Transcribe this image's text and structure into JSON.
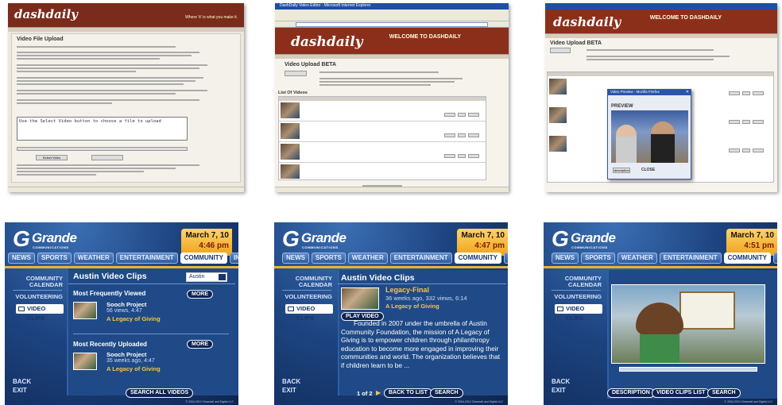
{
  "dashdaily": {
    "logo": "dashdaily",
    "welcome": "WELCOME TO DASHDAILY",
    "tagline": "Where 'it' is what you make it.",
    "upload_title": "Video File Upload",
    "upload_beta_title": "Video Upload BETA",
    "browser_title": "DashDaily Video Editor - Microsoft Internet Explorer",
    "list_title": "List Of Videos",
    "preview_window_title": "Video Preview - Mozilla Firefox",
    "preview_label": "PREVIEW",
    "preview_desc_btn": "description",
    "preview_close": "CLOSE",
    "textarea_text": "Use the Select Video button to choose a file to upload",
    "select_button": "Select Video",
    "upload_button": "Upload"
  },
  "grande": {
    "logo_word": "Grande",
    "logo_sub": "COMMUNICATIONS",
    "date": "March 7, 10",
    "tabs": [
      "NEWS",
      "SPORTS",
      "WEATHER",
      "ENTERTAINMENT",
      "COMMUNITY",
      "INFO"
    ],
    "nav": {
      "calendar": "COMMUNITY CALENDAR",
      "volunteering": "VOLUNTEERING",
      "video_clips": "VIDEO CLIPS",
      "back": "BACK",
      "exit": "EXIT"
    },
    "copyright": "© 2004-2010 Clearwell and Digital LLC",
    "screens": [
      {
        "time": "4:46 pm",
        "title": "Austin Video Clips",
        "city": "Austin",
        "most_viewed_label": "Most Frequently Viewed",
        "more": "MORE",
        "clip1_name": "Sooch Project",
        "clip1_meta": "56 views, 4:47",
        "clip1_sub": "A Legacy of Giving",
        "most_recent_label": "Most Recently Uploaded",
        "clip2_name": "Sooch Project",
        "clip2_meta": "35 weeks ago, 4:47",
        "clip2_sub": "A Legacy of Giving",
        "search_all": "SEARCH ALL VIDEOS"
      },
      {
        "time": "4:47 pm",
        "title": "Austin Video Clips",
        "clip_name": "Legacy-Final",
        "clip_meta": "36 weeks ago, 332 views, 6:14",
        "clip_sub": "A Legacy of Giving",
        "play": "PLAY VIDEO",
        "description": "Founded in 2007 under the umbrella of Austin Community Foundation, the mission of A Legacy of Giving is to empower children through philanthropy education to become more engaged in improving their communities and world. The organization believes that if children learn to be ...",
        "pager": "1 of 2",
        "back_to_list": "BACK TO LIST",
        "search": "SEARCH"
      },
      {
        "time": "4:51 pm",
        "video_progress": 0.0,
        "description_btn": "DESCRIPTION",
        "clips_list_btn": "VIDEO CLIPS LIST",
        "search": "SEARCH"
      }
    ]
  }
}
